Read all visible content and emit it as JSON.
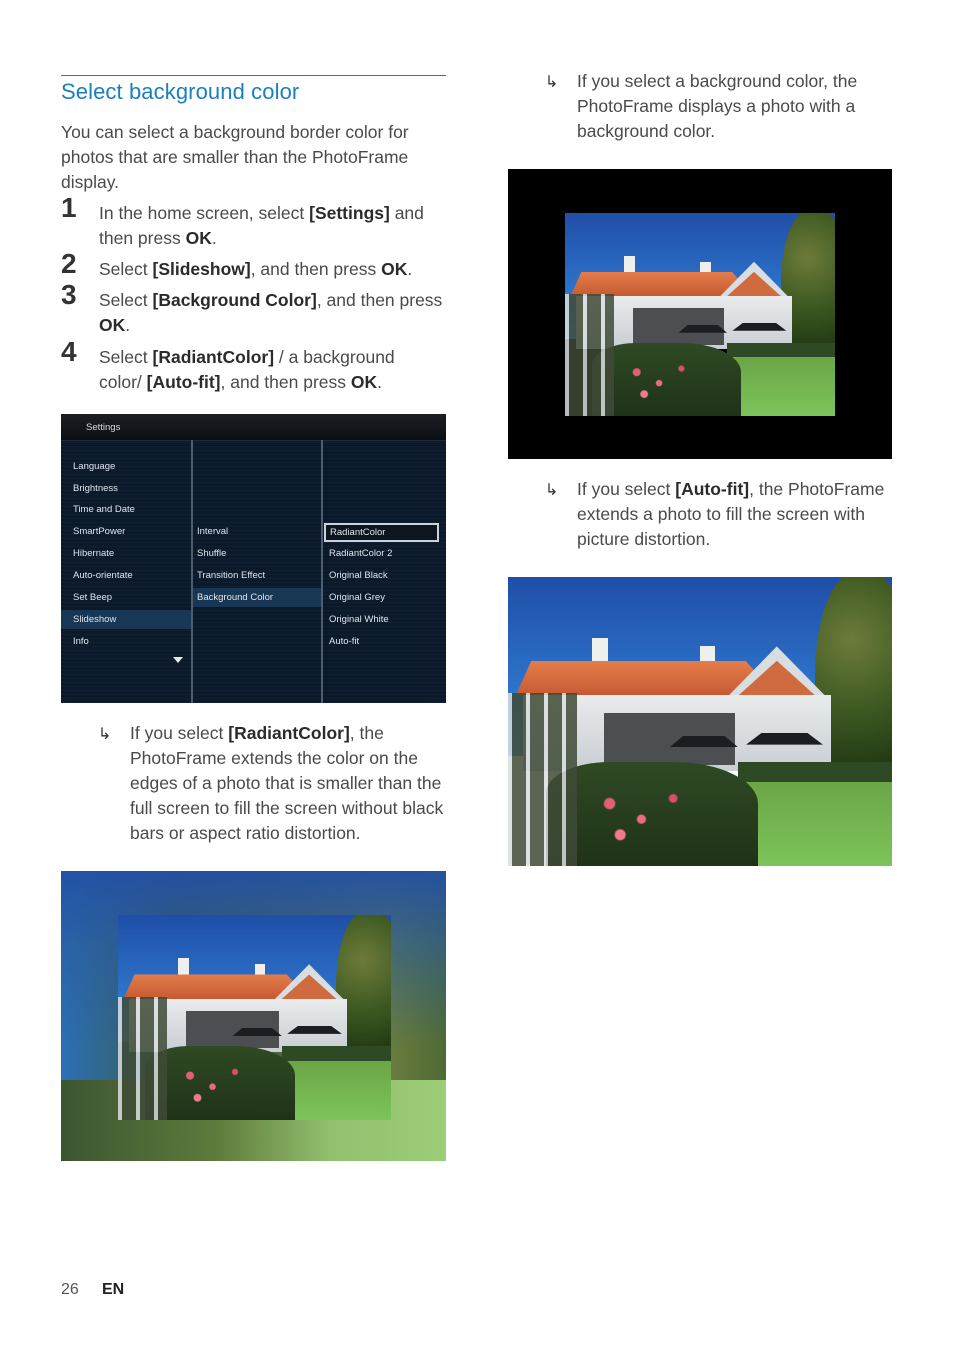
{
  "section": {
    "title": "Select background color",
    "intro": "You can select a background border color for photos that are smaller than the PhotoFrame display.",
    "accent_color": "#1a7fc1"
  },
  "steps": [
    {
      "num": "1",
      "pre": "In the home screen, select ",
      "key1": "[Settings]",
      "mid": " and then press ",
      "key2": "OK",
      "post": "."
    },
    {
      "num": "2",
      "pre": "Select ",
      "key1": "[Slideshow]",
      "mid": ", and then press ",
      "key2": "OK",
      "post": "."
    },
    {
      "num": "3",
      "pre": "Select ",
      "key1": "[Background Color]",
      "mid": ", and then press ",
      "key2": "OK",
      "post": "."
    },
    {
      "num": "4",
      "pre": "Select ",
      "key1": "[RadiantColor]",
      "mid": " / a background color/ ",
      "key2": "[Auto-fit]",
      "mid2": ", and then press ",
      "key3": "OK",
      "post": "."
    }
  ],
  "settings_screen": {
    "header": "Settings",
    "column1": [
      "Language",
      "Brightness",
      "Time and Date",
      "SmartPower",
      "Hibernate",
      "Auto-orientate",
      "Set Beep",
      "Slideshow",
      "Info"
    ],
    "column1_selected": "Slideshow",
    "column2": [
      "Interval",
      "Shuffle",
      "Transition Effect",
      "Background Color"
    ],
    "column2_selected": "Background Color",
    "column3": [
      "RadiantColor",
      "RadiantColor 2",
      "Original Black",
      "Original Grey",
      "Original White",
      "Auto-fit"
    ],
    "column3_focused": "RadiantColor"
  },
  "results": {
    "radiant": {
      "pre": "If you select ",
      "key": "[RadiantColor]",
      "post": ", the PhotoFrame extends the color on the edges of a photo that is smaller than the full screen to fill the screen without black bars or aspect ratio distortion."
    },
    "bgcolor": {
      "text": "If you select a background color, the PhotoFrame displays a photo with a background color."
    },
    "autofit": {
      "pre": "If you select ",
      "key": "[Auto-fit]",
      "post": ", the PhotoFrame extends a photo to fill the screen with picture distortion."
    }
  },
  "images": {
    "radiant_caption": "photo-with-radiant-color-background",
    "bgcolor_caption": "photo-with-black-background",
    "autofit_caption": "photo-auto-fit-full-screen"
  },
  "footer": {
    "page_number": "26",
    "language": "EN"
  }
}
